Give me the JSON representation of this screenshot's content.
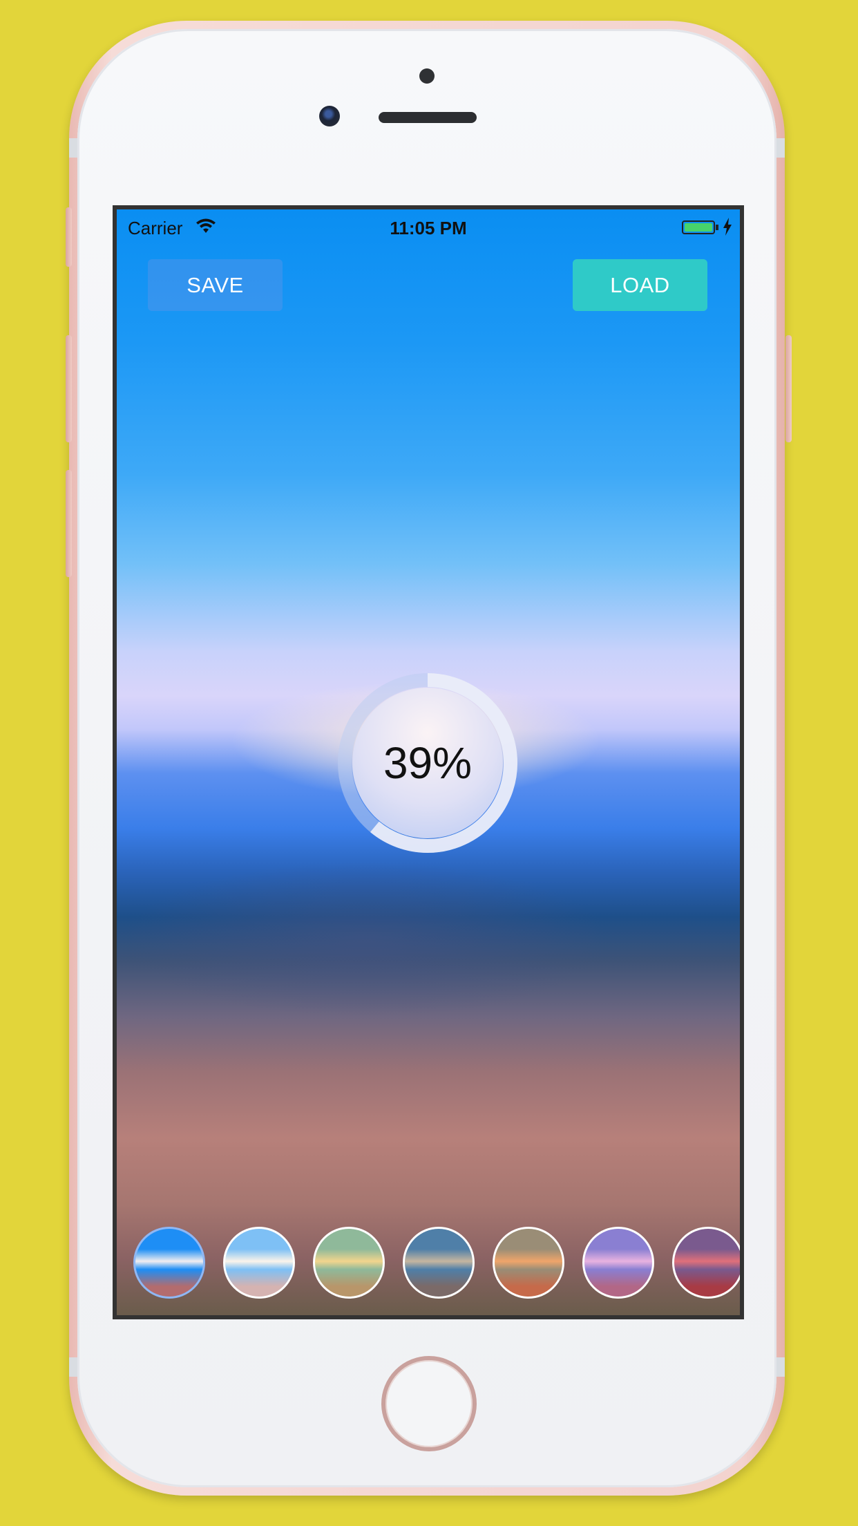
{
  "status_bar": {
    "carrier": "Carrier",
    "time": "11:05 PM",
    "wifi_icon": "wifi-icon",
    "battery_icon": "battery-charging-icon"
  },
  "toolbar": {
    "save_label": "SAVE",
    "load_label": "LOAD"
  },
  "progress": {
    "value_percent": 39,
    "label": "39%"
  },
  "filters": {
    "selected_index": 0,
    "items": [
      {
        "name": "filter-1",
        "colors": [
          "#1e8ef5",
          "#f2eef0",
          "#b36c6e"
        ]
      },
      {
        "name": "filter-2",
        "colors": [
          "#7ec0f5",
          "#fbf4ea",
          "#d5b3b1"
        ]
      },
      {
        "name": "filter-3",
        "colors": [
          "#8fb99a",
          "#f2d58d",
          "#b8966a"
        ]
      },
      {
        "name": "filter-4",
        "colors": [
          "#4f7fa8",
          "#c6b6a0",
          "#7b6a68"
        ]
      },
      {
        "name": "filter-5",
        "colors": [
          "#9a8d76",
          "#f0a56a",
          "#c66a4a"
        ]
      },
      {
        "name": "filter-6",
        "colors": [
          "#8a7fd2",
          "#e9b3e0",
          "#b26786"
        ]
      },
      {
        "name": "filter-7",
        "colors": [
          "#7a5a8e",
          "#e0707a",
          "#a83b44"
        ]
      }
    ]
  },
  "colors": {
    "background": "#e2d53a",
    "load_button": "#2fcac8",
    "selected_ring": "#8fb7f4"
  }
}
